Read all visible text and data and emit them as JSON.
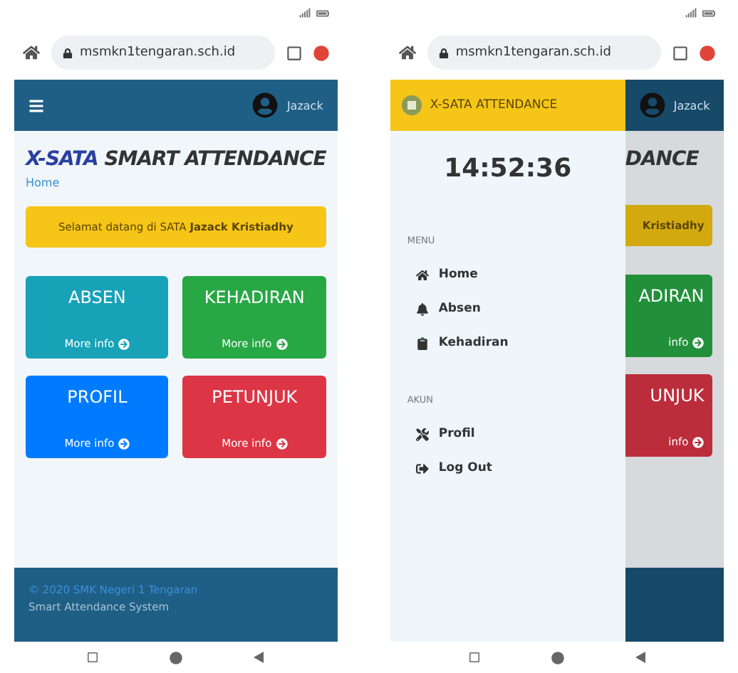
{
  "phones": [
    {
      "kind": "dashboard",
      "url": "msmkn1tengaran.sch.id",
      "user": "Jazack",
      "title_brand": "X-SATA",
      "title_rest": "SMART ATTENDANCE",
      "breadcrumb": "Home",
      "welcome": "Selamat datang di SATA **Jazack Kristiadhy**",
      "cards": [
        {
          "title": "ABSEN",
          "link": "More info",
          "color": "#17a2b8"
        },
        {
          "title": "KEHADIRAN",
          "link": "More info",
          "color": "#28a745"
        },
        {
          "title": "PROFIL",
          "link": "More info",
          "color": "#007bff"
        },
        {
          "title": "PETUNJUK",
          "link": "More info",
          "color": "#dc3545"
        }
      ],
      "footer": {
        "link": "© 2020 SMK Negeri 1 Tengaran",
        "text": "Smart Attendance System"
      }
    },
    {
      "kind": "drawer",
      "url": "msmkn1tengaran.sch.id",
      "drawer": {
        "brand": "X-SATA ATTENDANCE",
        "clock": "14:52:36",
        "sections": [
          {
            "heading": "MENU",
            "items": [
              {
                "label": "Home"
              },
              {
                "label": "Absen"
              },
              {
                "label": "Kehadiran"
              }
            ]
          },
          {
            "heading": "AKUN",
            "items": [
              {
                "label": "Profil"
              },
              {
                "label": "Log Out"
              }
            ]
          }
        ]
      },
      "behind": {
        "user": "Jazack",
        "title": "DANCE",
        "welcome": "Kristiadhy",
        "cards": [
          {
            "title": "ADIRAN",
            "link": "info",
            "color": "#22903b"
          },
          {
            "title": "UNJUK",
            "link": "info",
            "color": "#bb2d3b"
          }
        ]
      }
    }
  ]
}
